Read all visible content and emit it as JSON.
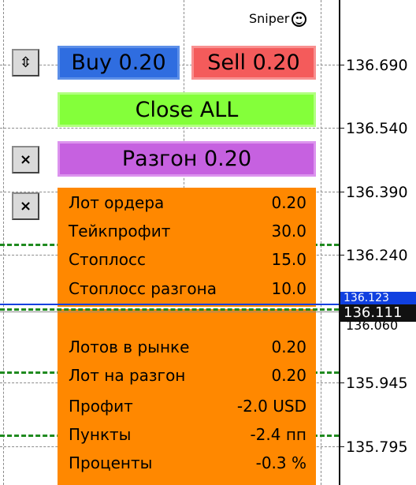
{
  "header": {
    "brand": "Sniper"
  },
  "buttons": {
    "buy": "Buy 0.20",
    "sell": "Sell 0.20",
    "close_all": "Close ALL",
    "razgon": "Разгон 0.20",
    "toggle_icon": "⇳",
    "close_icon": "×"
  },
  "panel": {
    "settings": [
      {
        "label": "Лот ордера",
        "value": "0.20"
      },
      {
        "label": "Тейкпрофит",
        "value": "30.0"
      },
      {
        "label": "Стоплосс",
        "value": "15.0"
      },
      {
        "label": "Стоплосс разгона",
        "value": "10.0"
      }
    ],
    "stats": [
      {
        "label": "Лотов в рынке",
        "value": "0.20"
      },
      {
        "label": "Лот на разгон",
        "value": "0.20"
      },
      {
        "label": "Профит",
        "value": "-2.0 USD"
      },
      {
        "label": "Пункты",
        "value": "-2.4 пп"
      },
      {
        "label": "Проценты",
        "value": "-0.3 %"
      }
    ]
  },
  "price_axis": {
    "labels": [
      "136.690",
      "136.540",
      "136.390",
      "136.240",
      "135.945",
      "135.795"
    ],
    "current_price": "136.111",
    "current_price_partial": "136.123",
    "current_price_below": "136.060"
  },
  "colors": {
    "buy": "#2f6de0",
    "sell": "#f45b5b",
    "close_all": "#84ff3a",
    "razgon": "#c661e0",
    "panel": "#ff8800",
    "level_lines": "#1f8a1f",
    "current_price_line": "#1040e0"
  }
}
